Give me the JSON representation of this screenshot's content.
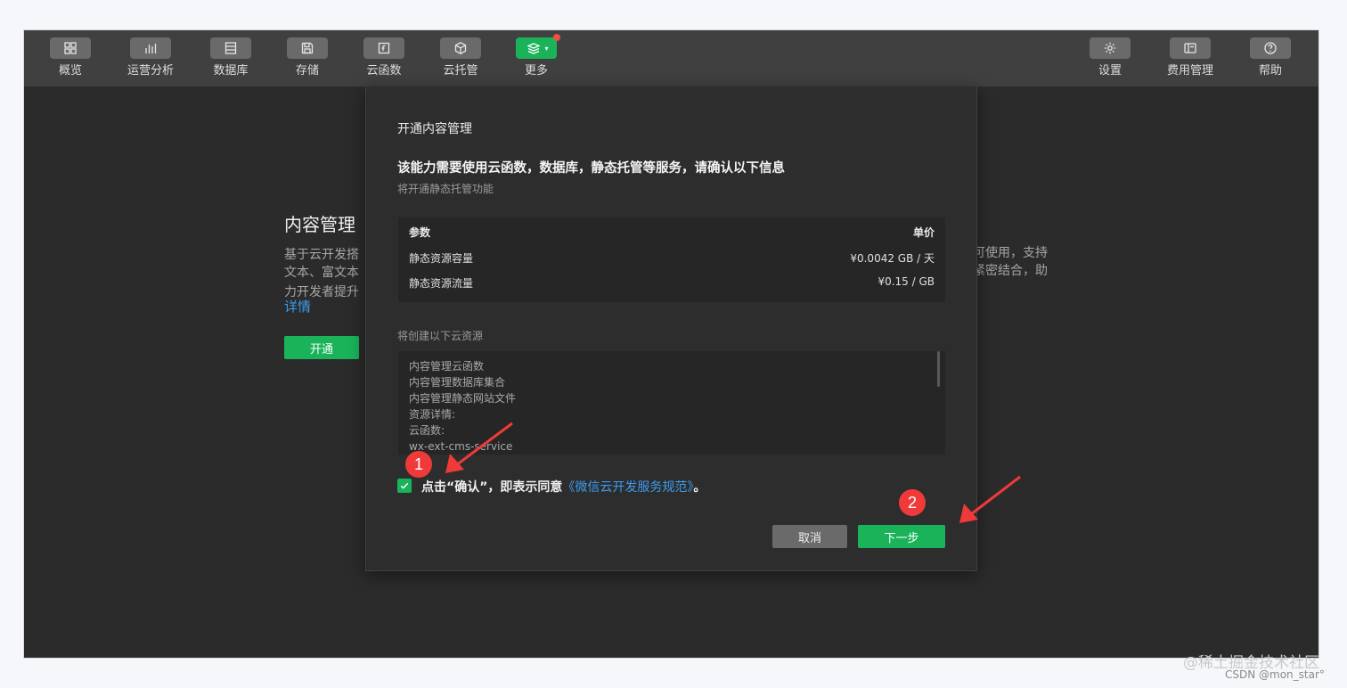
{
  "toolbar": {
    "left_items": [
      {
        "label": "概览",
        "icon": "grid-icon"
      },
      {
        "label": "运营分析",
        "icon": "bar-chart-icon"
      },
      {
        "label": "数据库",
        "icon": "database-icon"
      },
      {
        "label": "存储",
        "icon": "save-icon"
      },
      {
        "label": "云函数",
        "icon": "function-icon"
      },
      {
        "label": "云托管",
        "icon": "cube-icon"
      },
      {
        "label": "更多",
        "icon": "layers-icon",
        "active": true,
        "badge": "red-dot"
      }
    ],
    "right_items": [
      {
        "label": "设置",
        "icon": "gear-icon"
      },
      {
        "label": "费用管理",
        "icon": "billing-icon"
      },
      {
        "label": "帮助",
        "icon": "help-icon"
      }
    ]
  },
  "background": {
    "title": "内容管理",
    "desc_lines": [
      "基于云开发搭",
      "文本、富文本",
      "力开发者提升"
    ],
    "right_lines": [
      "可使用，支持",
      "紧密结合，助"
    ],
    "detail_link": "详情",
    "open_button": "开通"
  },
  "dialog": {
    "title": "开通内容管理",
    "heading": "该能力需要使用云函数，数据库，静态托管等服务，请确认以下信息",
    "subheading": "将开通静态托管功能",
    "price_table": {
      "headers": [
        "参数",
        "单价"
      ],
      "rows": [
        [
          "静态资源容量",
          "¥0.0042 GB / 天"
        ],
        [
          "静态资源流量",
          "¥0.15 / GB"
        ]
      ]
    },
    "resources_label": "将创建以下云资源",
    "resources": [
      "内容管理云函数",
      "内容管理数据库集合",
      "内容管理静态网站文件",
      "资源详情:",
      "云函数:",
      "wx-ext-cms-service"
    ],
    "agree_prefix": "点击“确认”，即表示同意",
    "agree_link": "《微信云开发服务规范》",
    "agree_suffix": "。",
    "cancel_button": "取消",
    "next_button": "下一步"
  },
  "annotations": {
    "step1": "1",
    "step2": "2",
    "arrow_color": "#f03a3a"
  },
  "watermark": {
    "line1": "@稀土掘金技术社区",
    "line2": "CSDN @mon_star°"
  },
  "colors": {
    "accent_green": "#1ab35a",
    "link_blue": "#3c9cf0",
    "toolbar_bg": "#404040",
    "window_bg": "#2b2b2b"
  }
}
